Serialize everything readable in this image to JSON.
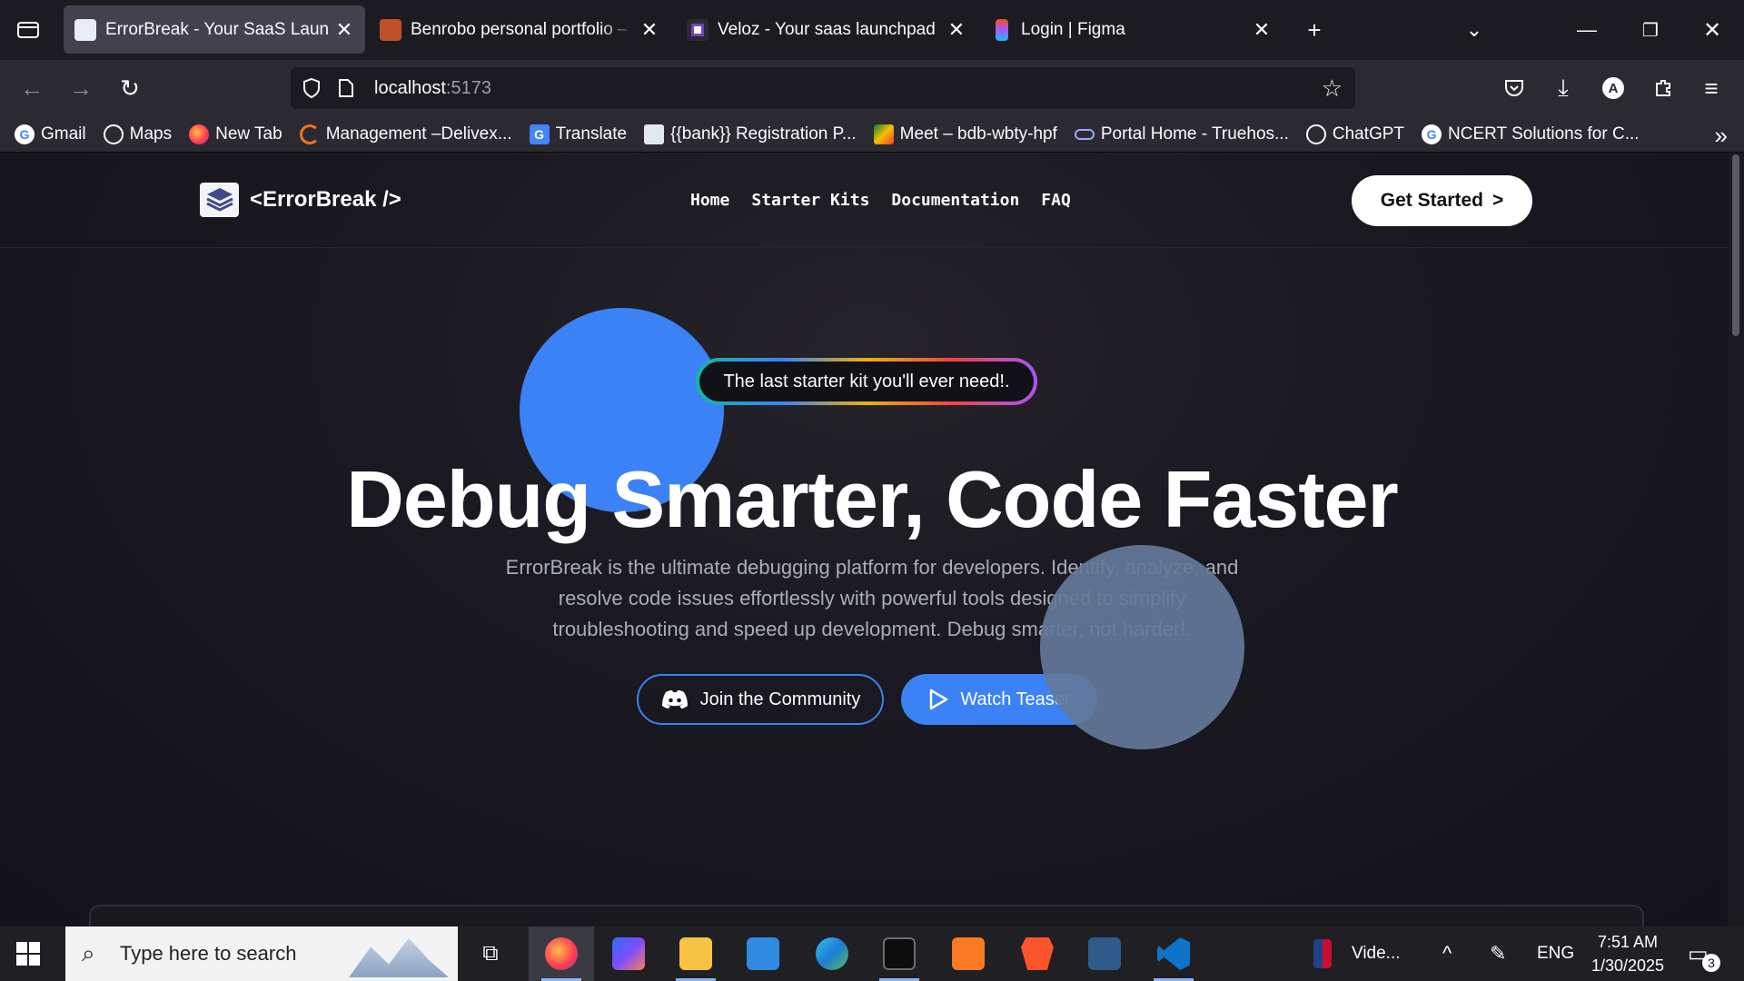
{
  "browser": {
    "tabs": [
      {
        "title": "ErrorBreak - Your SaaS Launchpad",
        "active": true
      },
      {
        "title": "Benrobo personal portfolio – Benrobo",
        "active": false
      },
      {
        "title": "Veloz - Your saas launchpad",
        "active": false
      },
      {
        "title": "Login | Figma",
        "active": false
      }
    ],
    "new_tab_symbol": "+",
    "url_host": "localhost",
    "url_port": ":5173",
    "bookmarks": [
      {
        "label": "Gmail",
        "icon": "google-icon"
      },
      {
        "label": "Maps",
        "icon": "globe-icon"
      },
      {
        "label": "New Tab",
        "icon": "firefox-icon"
      },
      {
        "label": "Management –Delivex...",
        "icon": "management-icon"
      },
      {
        "label": "Translate",
        "icon": "translate-icon"
      },
      {
        "label": "{{bank}} Registration P...",
        "icon": "bank-icon"
      },
      {
        "label": "Meet – bdb-wbty-hpf",
        "icon": "meet-icon"
      },
      {
        "label": "Portal Home - Truehos...",
        "icon": "cloud-icon"
      },
      {
        "label": "ChatGPT",
        "icon": "chatgpt-icon"
      },
      {
        "label": "NCERT Solutions for C...",
        "icon": "google-icon"
      }
    ],
    "profile_initial": "A"
  },
  "site": {
    "logo_text": "<ErrorBreak />",
    "nav": [
      "Home",
      "Starter Kits",
      "Documentation",
      "FAQ"
    ],
    "cta_label": "Get Started",
    "cta_arrow": ">",
    "badge": "The last starter kit you'll ever need!.",
    "headline": "Debug Smarter, Code Faster",
    "description": "ErrorBreak is the ultimate debugging platform for developers. Identify, analyze, and resolve code issues effortlessly with powerful tools designed to simplify troubleshooting and speed up development. Debug smarter, not harder!.",
    "community_label": "Join the Community",
    "teaser_label": "Watch Teaser",
    "colors": {
      "accent": "#3b82f6",
      "blob_gray": "#64789a",
      "bg": "#14121a"
    }
  },
  "taskbar": {
    "search_placeholder": "Type here to search",
    "tray_label": "Vide...",
    "language": "ENG",
    "time": "7:51 AM",
    "date": "1/30/2025",
    "notification_count": "3"
  }
}
